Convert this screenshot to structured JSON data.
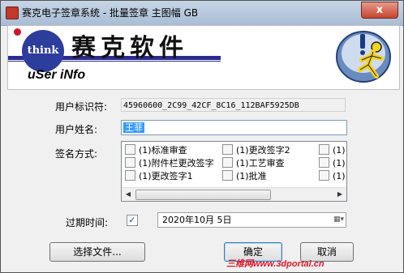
{
  "window": {
    "title": "赛克电子签章系统 - 批量签章 主图幅 GB",
    "close_glyph": "x"
  },
  "banner": {
    "logo_text": "think",
    "brand": "赛克软件",
    "tagline": "uSer iNfo",
    "mascot_icon": "aim-running-man-icon"
  },
  "form": {
    "user_id_label": "用户标识符:",
    "user_id_value": "45960600_2C99_42CF_8C16_112BAF5925DB",
    "user_name_label": "用户姓名:",
    "user_name_value": "王菲",
    "sign_mode_label": "签名方式:",
    "sign_options": [
      {
        "label": "(1)标准审查",
        "checked": false
      },
      {
        "label": "(1)更改签字2",
        "checked": false
      },
      {
        "label": "(1)",
        "checked": false
      },
      {
        "label": "(1)附件栏更改签字",
        "checked": false
      },
      {
        "label": "(1)工艺审查",
        "checked": false
      },
      {
        "label": "(1)",
        "checked": false
      },
      {
        "label": "(1)更改签字1",
        "checked": false
      },
      {
        "label": "(1)批准",
        "checked": false
      },
      {
        "label": "(1)",
        "checked": false
      }
    ],
    "expire_label": "过期时间:",
    "expire_checked": true,
    "expire_check_glyph": "✓",
    "expire_date": "2020年10月 5日"
  },
  "buttons": {
    "choose_file": "选择文件...",
    "ok": "确定",
    "cancel": "取消"
  },
  "watermark": "三维网www.3dportal.cn"
}
